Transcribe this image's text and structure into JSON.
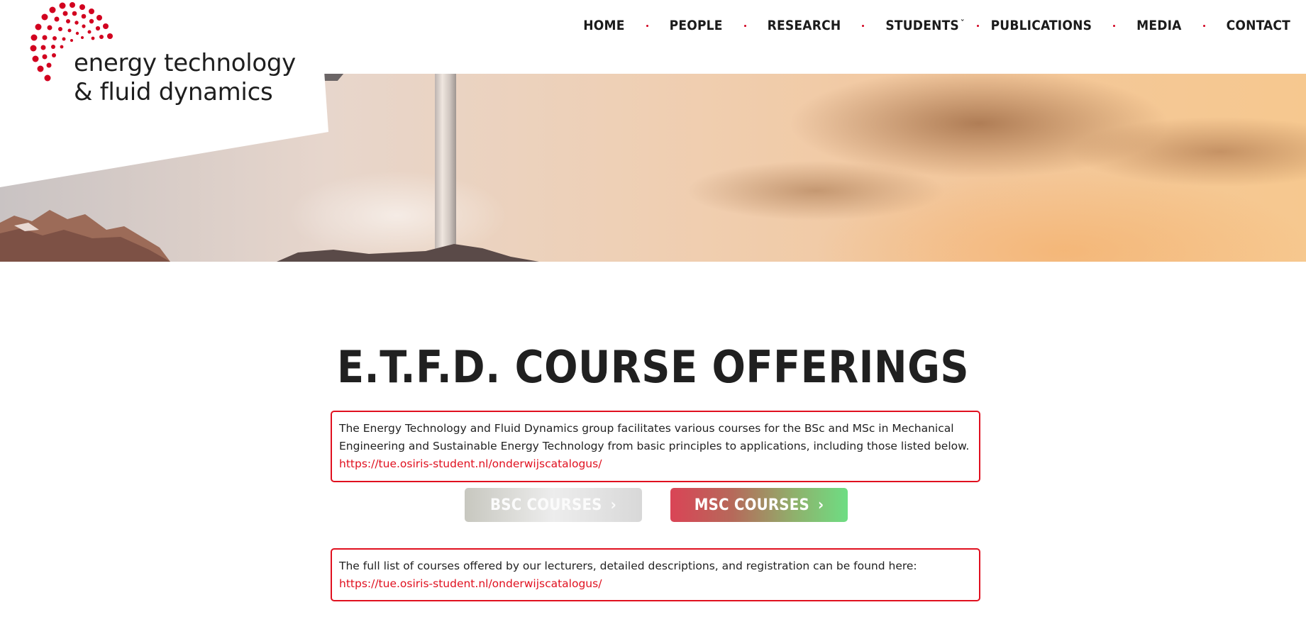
{
  "brand": {
    "line1": "energy technology",
    "line2": "& fluid dynamics",
    "logo_icon": "dot-burst-logo-icon",
    "accent_color": "#d2001f"
  },
  "nav": {
    "items": [
      {
        "label": "HOME"
      },
      {
        "label": "PEOPLE"
      },
      {
        "label": "RESEARCH"
      },
      {
        "label": "STUDENTS",
        "has_dropdown": true
      },
      {
        "label": "PUBLICATIONS"
      },
      {
        "label": "MEDIA"
      },
      {
        "label": "CONTACT"
      }
    ],
    "dropdown_icon": "chevron-down-icon"
  },
  "hero": {
    "image_description_icon": "wind-turbine-sunset-image"
  },
  "main": {
    "title": "E.T.F.D. COURSE OFFERINGS",
    "intro_text": "The Energy Technology and Fluid Dynamics group facilitates various courses for the BSc and MSc in Mechanical Engineering and Sustainable Energy Technology from basic principles to applications, including those listed below.",
    "intro_link": "https://tue.osiris-student.nl/onderwijscatalogus/",
    "buttons": {
      "bsc_label": "BSC COURSES",
      "msc_label": "MSC COURSES",
      "arrow": "›"
    },
    "full_list_text": "The full list of courses offered by our lecturers, detailed descriptions, and registration can be found here:",
    "full_list_link": "https://tue.osiris-student.nl/onderwijscatalogus/"
  }
}
